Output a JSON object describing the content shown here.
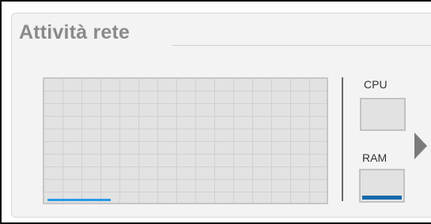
{
  "widget": {
    "title": "Attività rete"
  },
  "network_graph": {
    "activity_level": 0.23,
    "line_color": "#2a9ae6"
  },
  "meters": {
    "cpu": {
      "label": "CPU",
      "level": 0.0
    },
    "ram": {
      "label": "RAM",
      "level": 0.15,
      "fill_color": "#1769aa"
    }
  },
  "navigation": {
    "next_icon": "triangle-right-icon"
  }
}
